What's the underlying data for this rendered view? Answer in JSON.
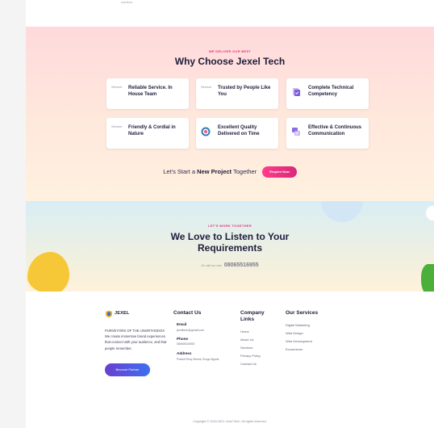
{
  "top": {
    "tiny_text": "solution."
  },
  "why": {
    "eyebrow": "WE DELIVER OUR BEST",
    "title": "Why Choose Jexel Tech",
    "cards": [
      {
        "icon_alt": "Service",
        "title": "Reliable Service. In House Team"
      },
      {
        "icon_alt": "Service",
        "title": "Trusted by People Like You"
      },
      {
        "icon": "document-check-icon",
        "title": "Complete Technical Competency"
      },
      {
        "icon_alt": "Service",
        "title": "Friendly & Cordial in Nature"
      },
      {
        "icon": "quality-badge-icon",
        "title": "Excellent Quality Delivered on Time"
      },
      {
        "icon": "chat-bubbles-icon",
        "title": "Effective & Continuous Communication"
      }
    ],
    "cta": {
      "prefix": "Let's Start a",
      "bold": "New Project",
      "suffix": "Together",
      "button": "Enquire Now"
    }
  },
  "listen": {
    "eyebrow": "LET'S WORK TOGETHER",
    "title_line1": "We Love to Listen to Your",
    "title_line2": "Requirements",
    "call_label": "Or call us now",
    "phone": "08065516955"
  },
  "footer": {
    "logo_text": "JEXEL",
    "about": "PURVEYORS OF THE UNORTHODOX We create immersive brand experiences that connect with your audience, and that people remember.",
    "partner_button": "Become Partner",
    "contact": {
      "heading": "Contact Us",
      "email_label": "Email",
      "email": "jexeltech@gmail.com",
      "phone_label": "Phone",
      "phone": "08065516955",
      "address_label": "Address",
      "address": "Prada 8 Ebuy Streets, Enugu Nigeria"
    },
    "company": {
      "heading_line1": "Company",
      "heading_line2": "Links",
      "links": [
        "Home",
        "About Us",
        "Services",
        "Privacy Policy",
        "Contact Us"
      ]
    },
    "services": {
      "heading": "Our Services",
      "links": [
        "Digital Marketing",
        "Web Design",
        "Web Development",
        "Ecommerce"
      ]
    },
    "copyright": "Copyright © 2020-2021 Jexel Tech. All rights reserved."
  }
}
